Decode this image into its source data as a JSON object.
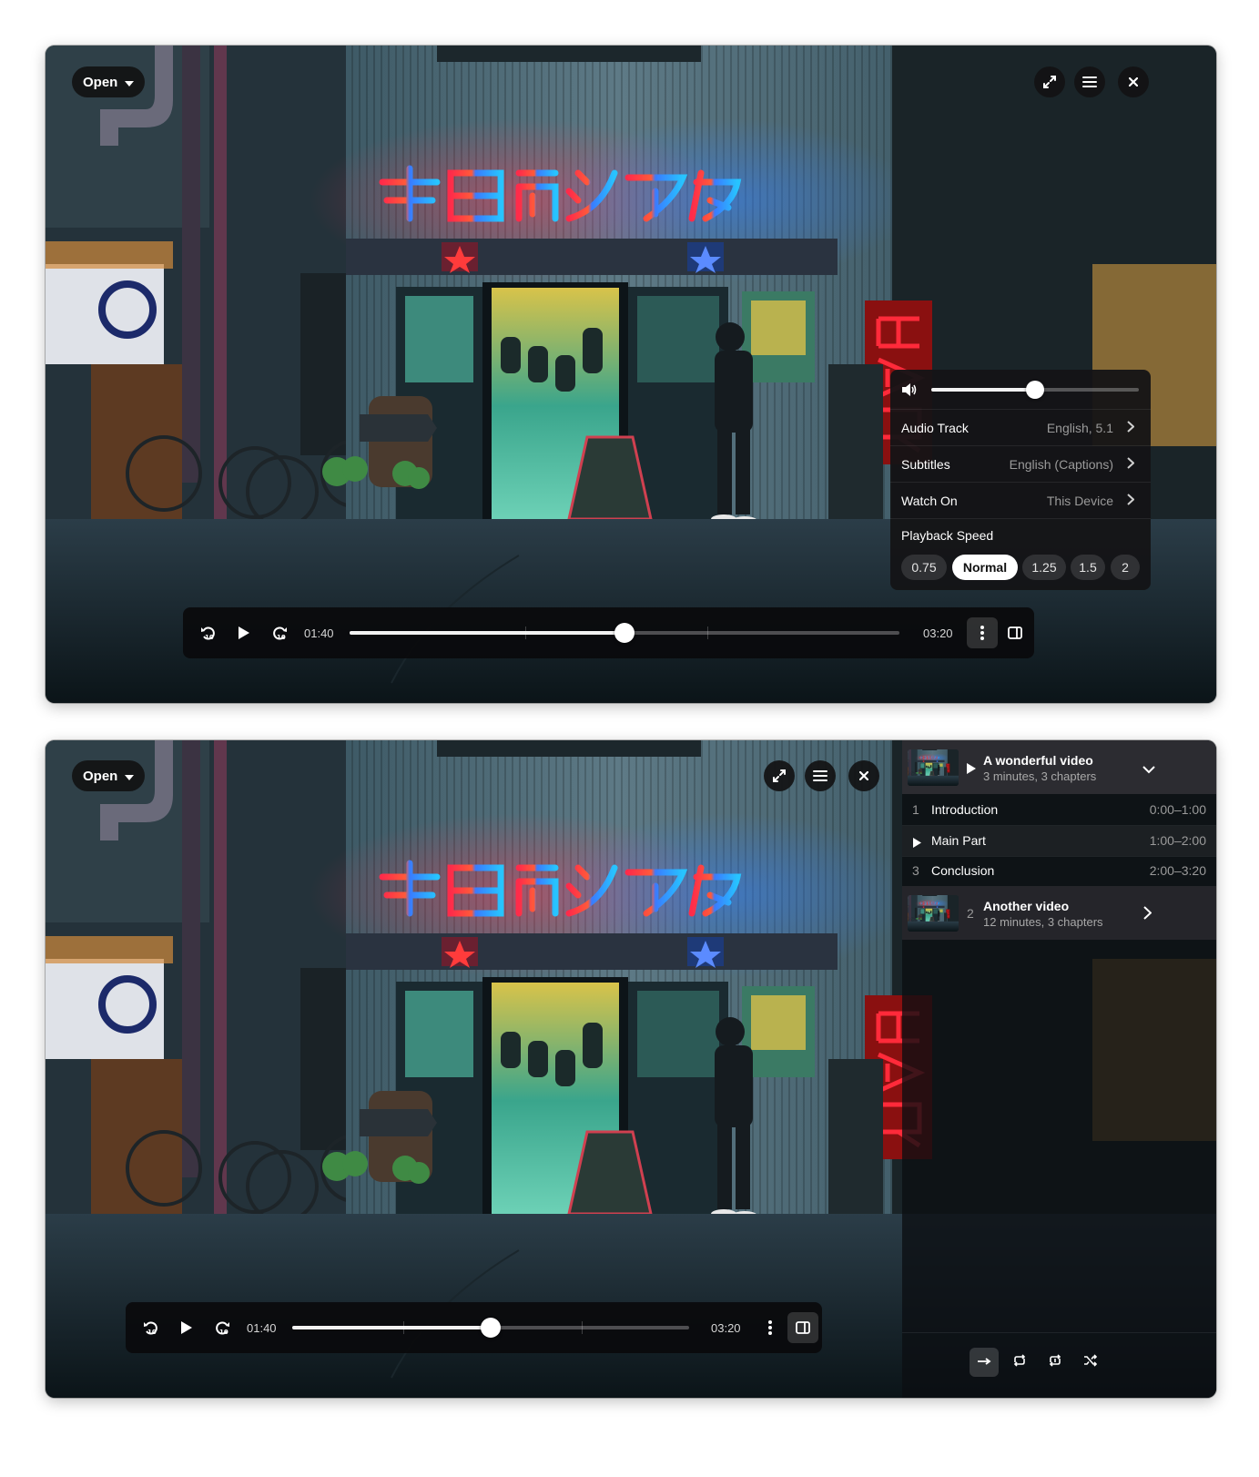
{
  "top": {
    "open_label": "Open",
    "controls": {
      "elapsed": "01:40",
      "duration": "03:20",
      "progress": 0.5,
      "chapter_marks": [
        0.32,
        0.65
      ]
    },
    "menu": {
      "volume": 0.5,
      "rows": [
        {
          "label": "Audio Track",
          "value": "English, 5.1"
        },
        {
          "label": "Subtitles",
          "value": "English (Captions)"
        },
        {
          "label": "Watch On",
          "value": "This Device"
        }
      ],
      "speed_label": "Playback Speed",
      "speeds": [
        "0.75",
        "Normal",
        "1.25",
        "1.5",
        "2"
      ],
      "selected_speed": "Normal"
    }
  },
  "bottom": {
    "open_label": "Open",
    "controls": {
      "elapsed": "01:40",
      "duration": "03:20",
      "progress": 0.5,
      "chapter_marks": [
        0.28,
        0.73
      ]
    },
    "playlist": {
      "current": {
        "title": "A wonderful video",
        "subtitle": "3 minutes, 3 chapters"
      },
      "chapters": [
        {
          "number": "1",
          "name": "Introduction",
          "range": "0:00–1:00"
        },
        {
          "number": "",
          "name": "Main Part",
          "range": "1:00–2:00"
        },
        {
          "number": "3",
          "name": "Conclusion",
          "range": "2:00–3:20"
        }
      ],
      "next": {
        "number": "2",
        "title": "Another video",
        "subtitle": "12 minutes, 3 chapters"
      }
    }
  },
  "icons": [
    "chevron-down-icon",
    "fullscreen-icon",
    "menu-icon",
    "close-icon",
    "replay-10-icon",
    "play-icon",
    "forward-10-icon",
    "more-vertical-icon",
    "sidebar-icon",
    "volume-icon",
    "chevron-right-icon",
    "repeat-none-icon",
    "repeat-all-icon",
    "repeat-one-icon",
    "shuffle-icon"
  ],
  "colors": {
    "sign_red": "#ff2b4a",
    "sign_blue": "#2fa8ff",
    "bar_red": "#ff2a3a",
    "accent_white": "#ffffff"
  }
}
